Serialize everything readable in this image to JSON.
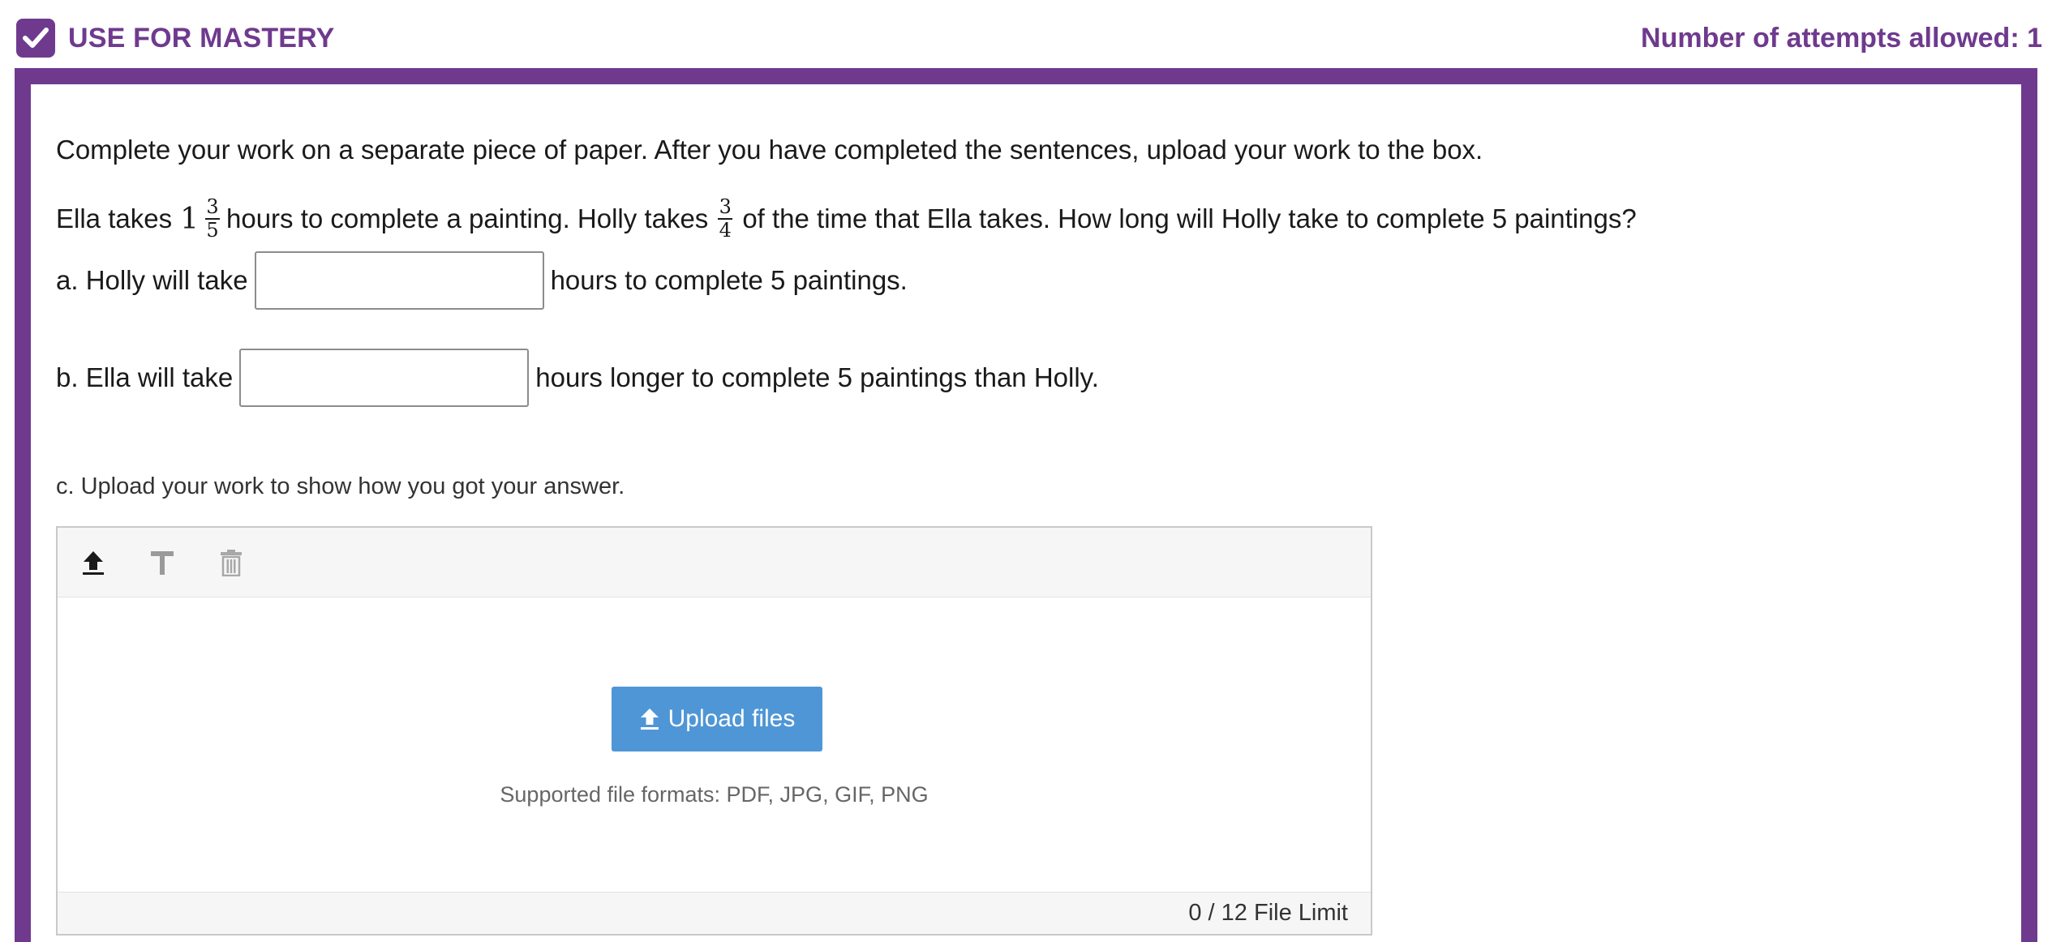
{
  "header": {
    "mastery_label": "USE FOR MASTERY",
    "attempts_label": "Number of attempts allowed: 1"
  },
  "question": {
    "instruction": "Complete your work on a separate piece of paper. After you have completed the sentences, upload your work to the box.",
    "problem_part1": "Ella takes",
    "ella_time": {
      "whole": "1",
      "numerator": "3",
      "denominator": "5"
    },
    "problem_part2": "hours to complete a painting. Holly takes",
    "holly_fraction": {
      "numerator": "3",
      "denominator": "4"
    },
    "problem_part3": "of the time that Ella takes. How long will Holly take to complete 5 paintings?",
    "part_a": {
      "prefix": "a. Holly will take",
      "value": "",
      "suffix": "hours to complete 5 paintings."
    },
    "part_b": {
      "prefix": "b. Ella will take",
      "value": "",
      "suffix": "hours longer to complete 5 paintings than Holly."
    },
    "part_c": "c. Upload your work to show how you got your answer."
  },
  "uploader": {
    "upload_button_label": "Upload files",
    "formats_text": "Supported file formats: PDF, JPG, GIF, PNG",
    "file_limit_text": "0 / 12 File Limit",
    "tools": [
      "upload-icon",
      "text-icon",
      "trash-icon"
    ]
  },
  "colors": {
    "brand_purple": "#6f3a8e",
    "upload_button": "#4f96d6",
    "toolbar_bg": "#f6f6f6"
  }
}
